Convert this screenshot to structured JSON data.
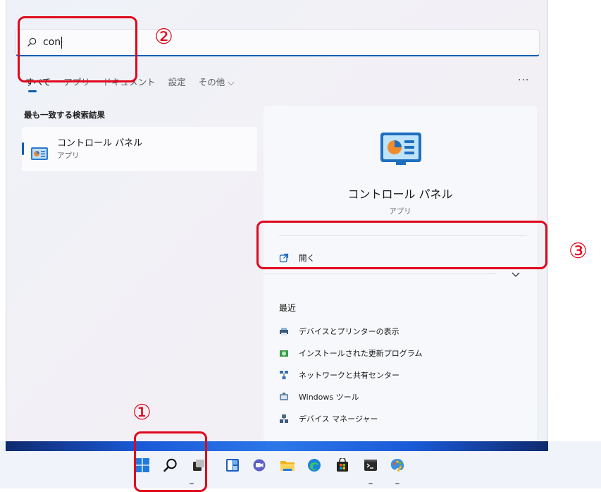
{
  "search": {
    "value": "con"
  },
  "tabs": [
    {
      "label": "すべて",
      "active": true
    },
    {
      "label": "アプリ"
    },
    {
      "label": "ドキュメント"
    },
    {
      "label": "設定"
    },
    {
      "label": "その他 ⌵"
    }
  ],
  "more_label": "···",
  "best_match": {
    "heading": "最も一致する検索結果",
    "title": "コントロール パネル",
    "subtitle": "アプリ"
  },
  "detail": {
    "title": "コントロール パネル",
    "subtitle": "アプリ",
    "open_label": "開く",
    "recent_heading": "最近",
    "recent": [
      {
        "label": "デバイスとプリンターの表示",
        "icon": "printer-icon"
      },
      {
        "label": "インストールされた更新プログラム",
        "icon": "updates-icon"
      },
      {
        "label": "ネットワークと共有センター",
        "icon": "network-icon"
      },
      {
        "label": "Windows ツール",
        "icon": "tools-icon"
      },
      {
        "label": "デバイス マネージャー",
        "icon": "device-manager-icon"
      }
    ]
  },
  "annotations": {
    "one": "①",
    "two": "②",
    "three": "③"
  },
  "taskbar": [
    "start-icon",
    "search-icon",
    "task-view-icon",
    "widgets-icon",
    "chat-icon",
    "file-explorer-icon",
    "edge-icon",
    "store-icon",
    "terminal-icon",
    "paint-icon"
  ],
  "colors": {
    "accent": "#0a5fb4",
    "annotation": "#e0071b"
  }
}
